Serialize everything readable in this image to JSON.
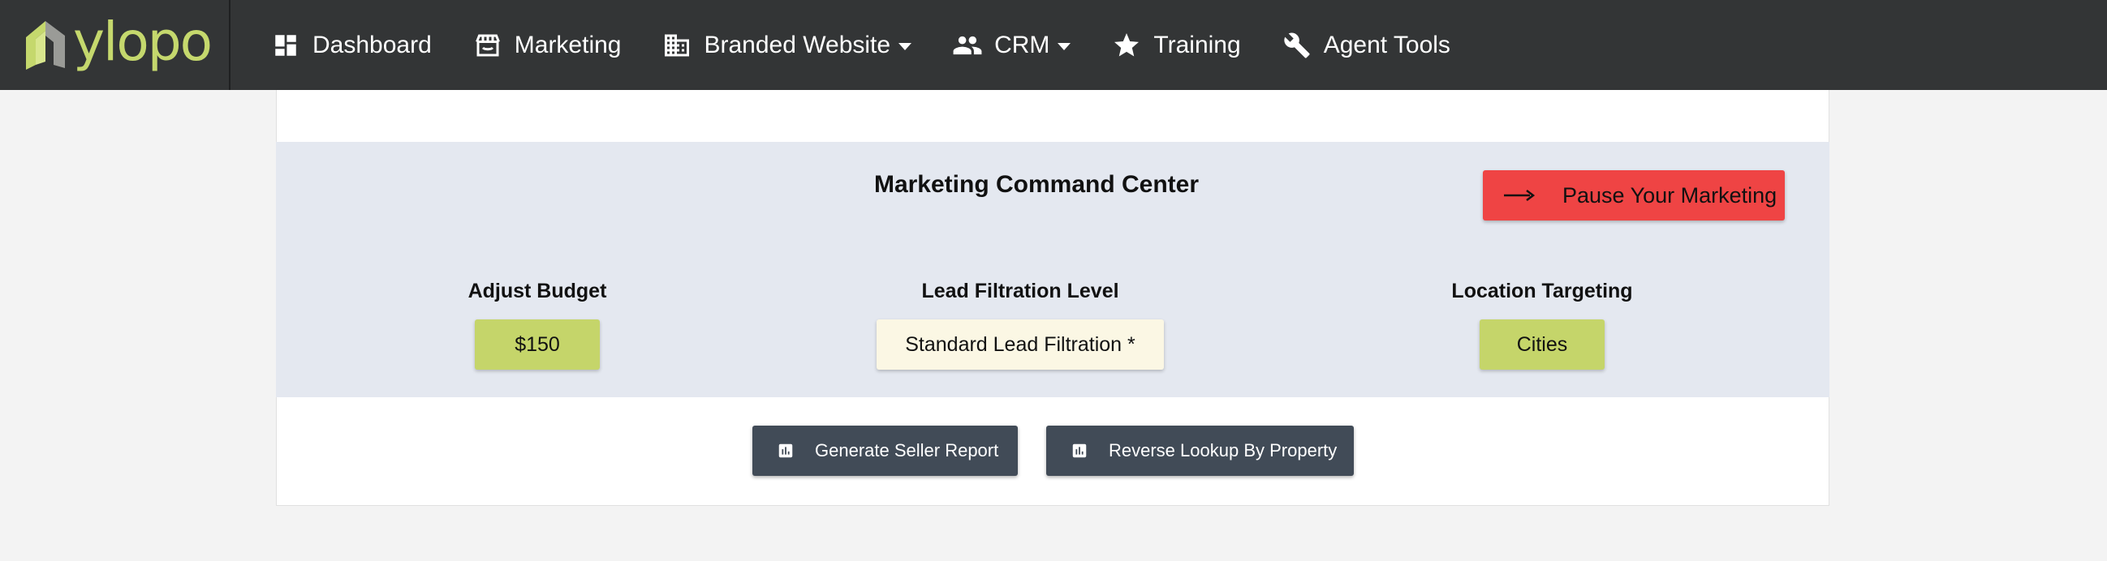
{
  "brand": {
    "name": "ylopo"
  },
  "nav": {
    "items": [
      {
        "label": "Dashboard",
        "icon": "dashboard-icon"
      },
      {
        "label": "Marketing",
        "icon": "storefront-icon"
      },
      {
        "label": "Branded Website",
        "icon": "building-icon",
        "dropdown": true
      },
      {
        "label": "CRM",
        "icon": "people-icon",
        "dropdown": true
      },
      {
        "label": "Training",
        "icon": "star-icon"
      },
      {
        "label": "Agent Tools",
        "icon": "wrench-icon"
      }
    ]
  },
  "command_center": {
    "title": "Marketing Command Center",
    "pause_button": "Pause Your Marketing",
    "budget": {
      "label": "Adjust Budget",
      "value": "$150"
    },
    "filtration": {
      "label": "Lead Filtration Level",
      "value": "Standard Lead Filtration *"
    },
    "location": {
      "label": "Location Targeting",
      "value": "Cities"
    }
  },
  "actions": {
    "seller_report": "Generate Seller Report",
    "reverse_lookup": "Reverse Lookup By Property"
  },
  "colors": {
    "navbar": "#333536",
    "brand_green": "#c5d86d",
    "pause_red": "#ef4444",
    "panel_blue": "#e4e8f0",
    "button_green": "#c5d56a",
    "button_cream": "#fbf7e4",
    "button_dark": "#414b57"
  }
}
